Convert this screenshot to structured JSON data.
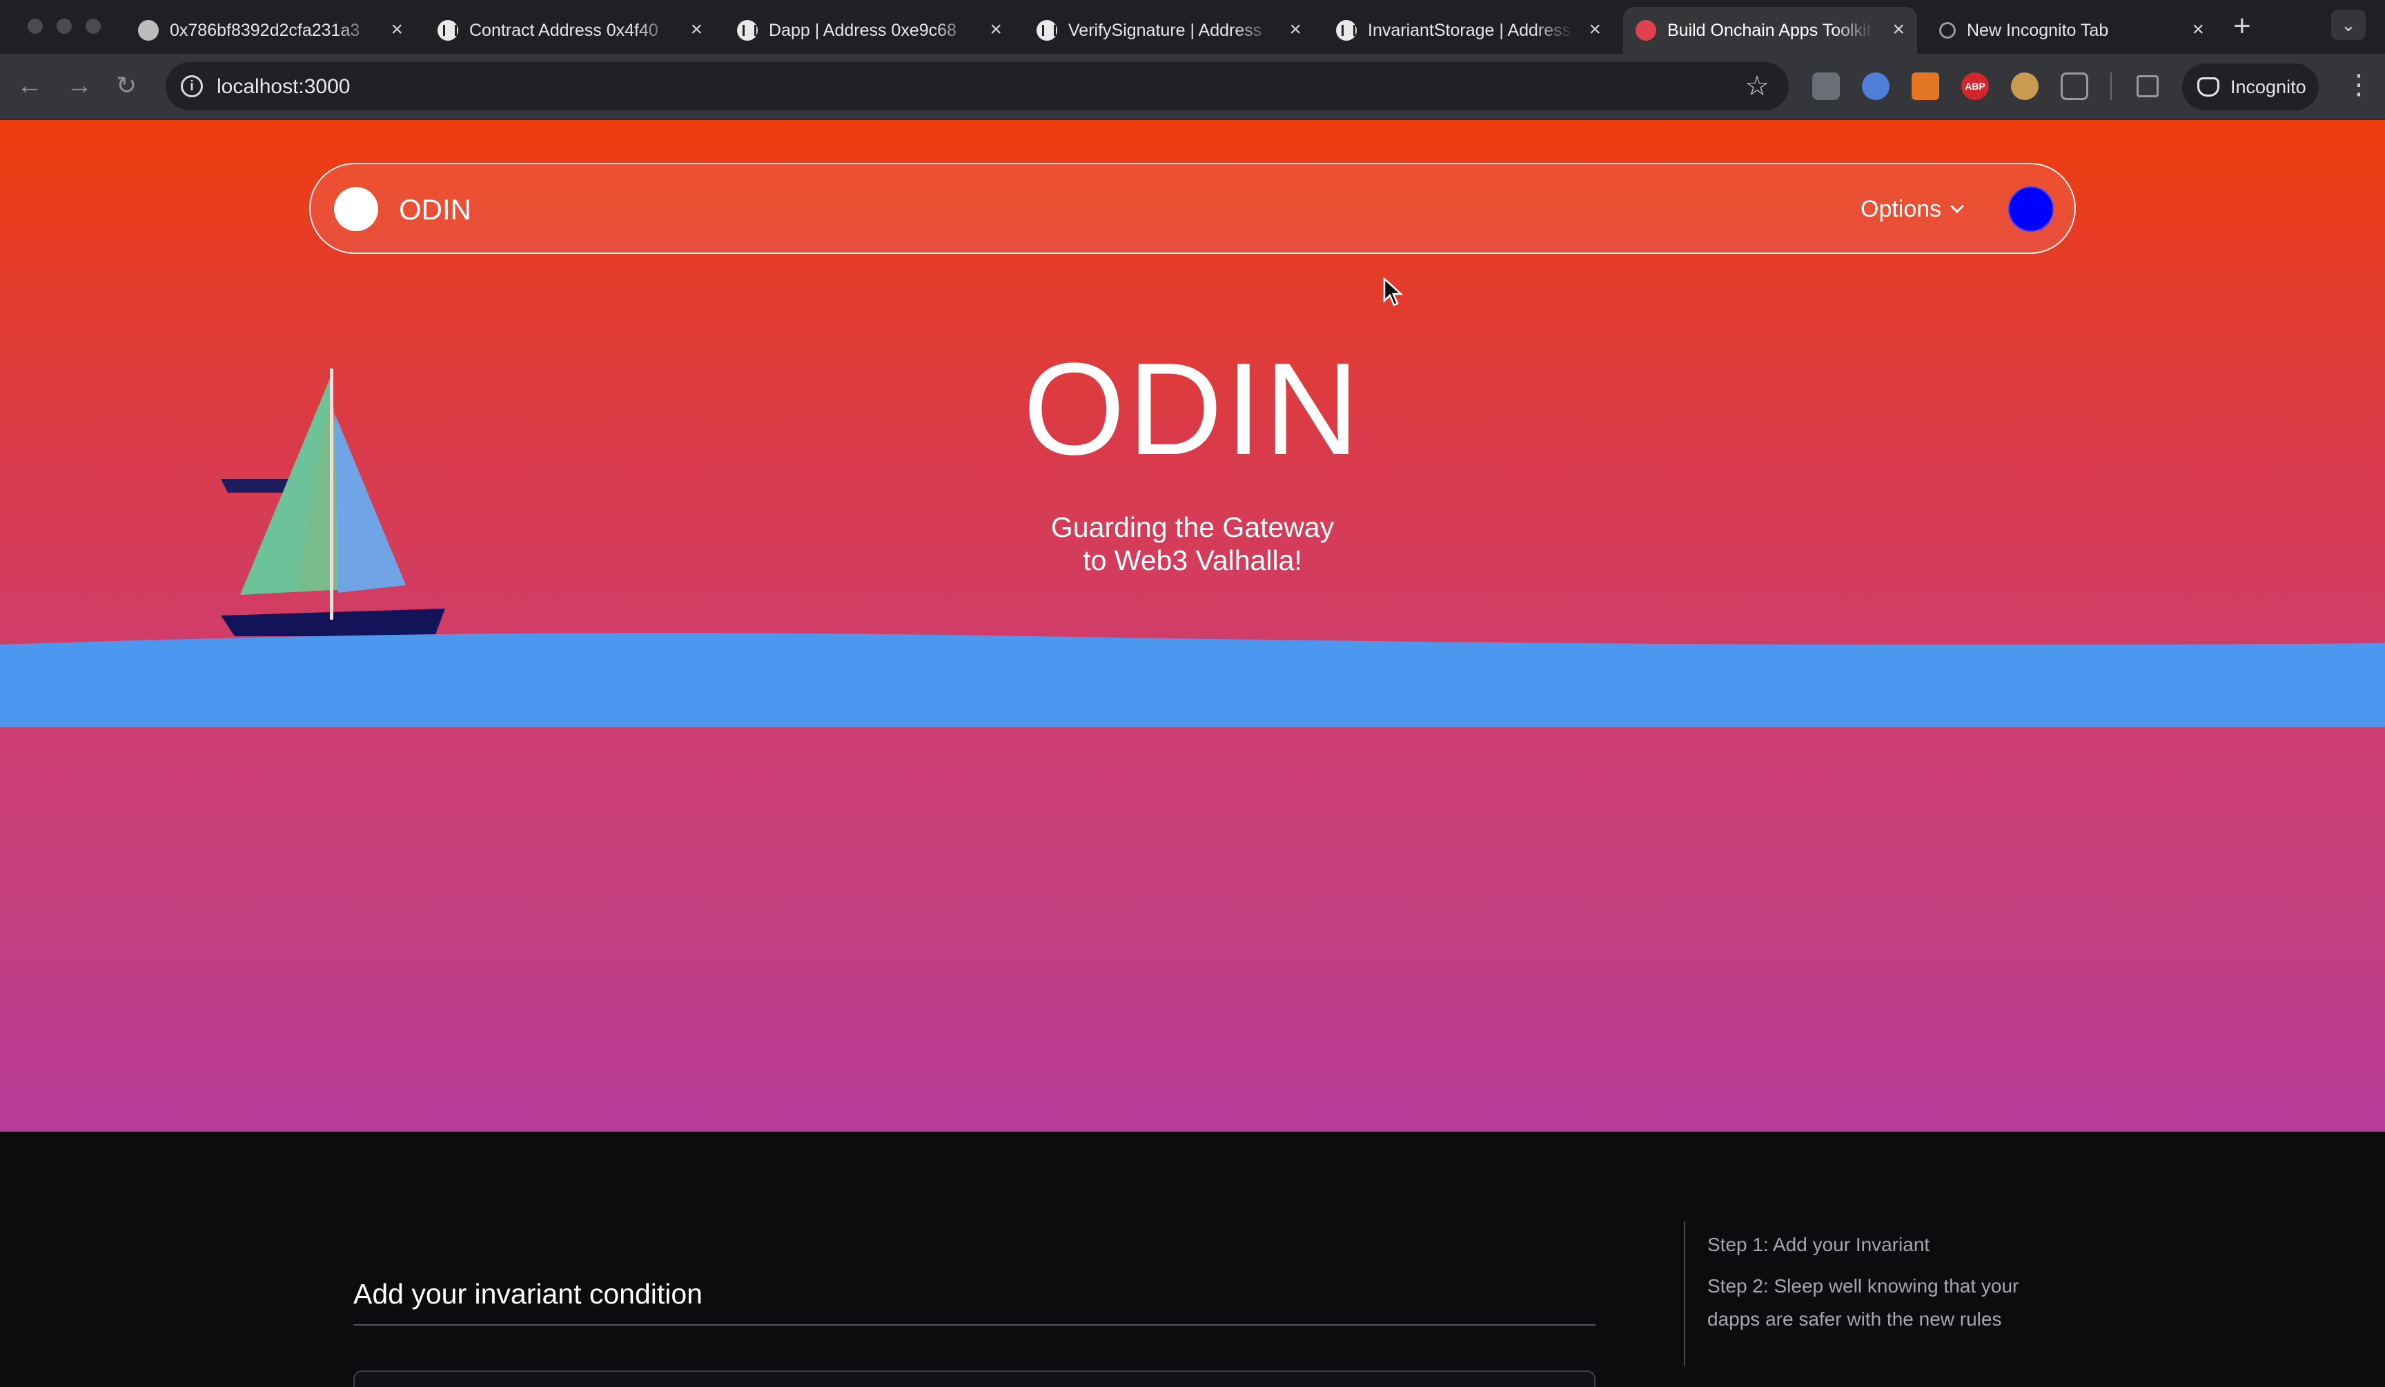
{
  "browser": {
    "tabs": [
      {
        "title": "0x786bf8392d2cfa231a3",
        "icon": "globe-icon"
      },
      {
        "title": "Contract Address 0x4f40",
        "icon": "etherscan-icon"
      },
      {
        "title": "Dapp | Address 0xe9c68",
        "icon": "etherscan-icon"
      },
      {
        "title": "VerifySignature | Address",
        "icon": "etherscan-icon"
      },
      {
        "title": "InvariantStorage | Address",
        "icon": "etherscan-icon"
      },
      {
        "title": "Build Onchain Apps Toolkit",
        "icon": "red-dot-icon",
        "active": true
      },
      {
        "title": "New Incognito Tab",
        "icon": "incognito-icon"
      }
    ],
    "url": "localhost:3000",
    "extensions": [
      {
        "name": "extension-icon",
        "label": ""
      },
      {
        "name": "extension-icon",
        "label": ""
      },
      {
        "name": "metamask-icon",
        "label": ""
      },
      {
        "name": "adblock-icon",
        "label": "ABP"
      },
      {
        "name": "cookie-icon",
        "label": ""
      },
      {
        "name": "puzzle-icon",
        "label": ""
      }
    ],
    "incognito_label": "Incognito"
  },
  "nav": {
    "brand": "ODIN",
    "options_label": "Options",
    "avatar_color": "#0000ff"
  },
  "hero": {
    "title": "ODIN",
    "tagline_line1": "Guarding the Gateway",
    "tagline_line2": "to Web3 Valhalla!"
  },
  "form": {
    "title": "Add your invariant condition"
  },
  "steps": {
    "step1": "Step 1: Add your Invariant",
    "step2_line1": "Step 2: Sleep well knowing that your",
    "step2_line2": "dapps are safer with the new rules"
  },
  "colors": {
    "gradient_top": "#ee3d0e",
    "gradient_bottom": "#b73b98",
    "sea": "#4d97ef",
    "dark_bg": "#0b0c0e"
  }
}
